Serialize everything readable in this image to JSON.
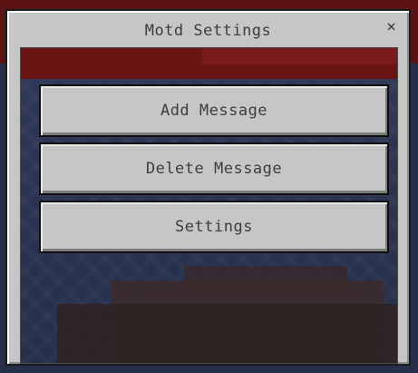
{
  "window": {
    "title": "Motd Settings",
    "close_glyph": "×"
  },
  "buttons": [
    {
      "label": "Add Message"
    },
    {
      "label": "Delete Message"
    },
    {
      "label": "Settings"
    }
  ],
  "colors": {
    "panel": "#c6c6c6",
    "text": "#3d3d3d",
    "border": "#0f0f0f"
  },
  "icons": {
    "close": "close-icon"
  }
}
